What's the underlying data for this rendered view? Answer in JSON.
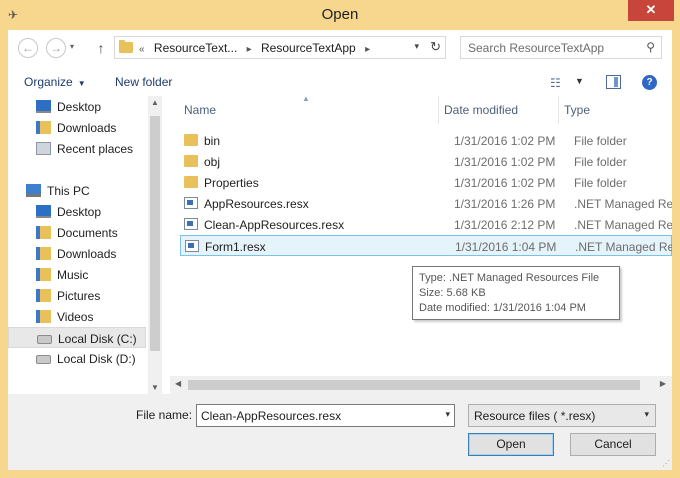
{
  "window": {
    "title": "Open",
    "close_label": "✕"
  },
  "navbar": {
    "back_glyph": "←",
    "forward_glyph": "→",
    "up_glyph": "↑",
    "crumbs": [
      "«",
      "ResourceText...",
      "▸",
      "ResourceTextApp",
      "▸"
    ],
    "refresh_glyph": "↻",
    "search_placeholder": "Search ResourceTextApp",
    "search_glyph": "⚲"
  },
  "toolbar": {
    "organize_label": "Organize",
    "new_folder_label": "New folder",
    "help_glyph": "?"
  },
  "nav_items": [
    {
      "label": "Desktop",
      "icon": "desktop-icon",
      "indent": 1
    },
    {
      "label": "Downloads",
      "icon": "downloads-folder-icon",
      "indent": 1
    },
    {
      "label": "Recent places",
      "icon": "recent-places-icon",
      "indent": 1
    },
    {
      "label": "This PC",
      "icon": "computer-icon",
      "indent": 0
    },
    {
      "label": "Desktop",
      "icon": "desktop-icon",
      "indent": 1
    },
    {
      "label": "Documents",
      "icon": "documents-folder-icon",
      "indent": 1
    },
    {
      "label": "Downloads",
      "icon": "downloads-folder-icon",
      "indent": 1
    },
    {
      "label": "Music",
      "icon": "music-folder-icon",
      "indent": 1
    },
    {
      "label": "Pictures",
      "icon": "pictures-folder-icon",
      "indent": 1
    },
    {
      "label": "Videos",
      "icon": "videos-folder-icon",
      "indent": 1
    },
    {
      "label": "Local Disk (C:)",
      "icon": "system-disk-icon",
      "indent": 1,
      "selected": true
    },
    {
      "label": "Local Disk (D:)",
      "icon": "disk-icon",
      "indent": 1
    }
  ],
  "columns": {
    "name": "Name",
    "date": "Date modified",
    "type": "Type"
  },
  "files": [
    {
      "name": "bin",
      "date": "1/31/2016 1:02 PM",
      "type": "File folder",
      "kind": "folder"
    },
    {
      "name": "obj",
      "date": "1/31/2016 1:02 PM",
      "type": "File folder",
      "kind": "folder"
    },
    {
      "name": "Properties",
      "date": "1/31/2016 1:02 PM",
      "type": "File folder",
      "kind": "folder"
    },
    {
      "name": "AppResources.resx",
      "date": "1/31/2016 1:26 PM",
      "type": ".NET Managed Re...",
      "kind": "resx"
    },
    {
      "name": "Clean-AppResources.resx",
      "date": "1/31/2016 2:12 PM",
      "type": ".NET Managed Re...",
      "kind": "resx"
    },
    {
      "name": "Form1.resx",
      "date": "1/31/2016 1:04 PM",
      "type": ".NET Managed Re...",
      "kind": "resx",
      "selected": true
    }
  ],
  "tooltip": {
    "type_line": "Type: .NET Managed Resources File",
    "size_line": "Size: 5.68 KB",
    "date_line": "Date modified: 1/31/2016 1:04 PM"
  },
  "bottom": {
    "file_name_label": "File name:",
    "file_name_value": "Clean-AppResources.resx",
    "filter_value": "Resource files  ( *.resx)",
    "open_label": "Open",
    "cancel_label": "Cancel"
  }
}
